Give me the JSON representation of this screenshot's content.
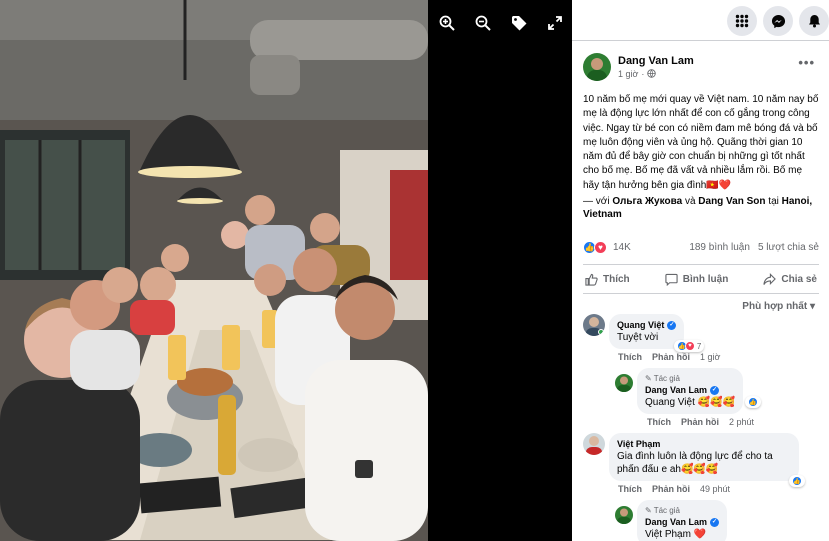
{
  "viewer": {
    "tools": [
      "zoom-in-icon",
      "zoom-out-icon",
      "tag-icon",
      "fullscreen-icon"
    ]
  },
  "topbar": {
    "icons": [
      "menu-grid-icon",
      "messenger-icon",
      "notifications-icon"
    ]
  },
  "post": {
    "author": "Dang Van Lam",
    "time": "1 giờ",
    "text": "10 năm bố mẹ mới quay về Việt nam. 10 năm nay bố mẹ là động lực lớn nhất để con cố gắng trong công việc. Ngay từ bé con có niềm đam mê bóng đá và bố mẹ luôn động viên và ủng hộ. Quãng thời gian 10 năm đủ để bây giờ con chuẩn bị những gì tốt nhất cho bố mẹ. Bố mẹ đã vất vả nhiều lắm rồi. Bố mẹ hãy tận hưởng bên gia đình🇻🇳❤️",
    "with_prefix": "— với",
    "with_person1": "Ольга Жукова",
    "with_and": "và",
    "with_person2": "Dang Van Son",
    "with_at": "tại",
    "location": "Hanoi, Vietnam",
    "reactions_count": "14K",
    "comments_count": "189 bình luận",
    "shares_count": "5 lượt chia sẻ"
  },
  "actions": {
    "like": "Thích",
    "comment": "Bình luận",
    "share": "Chia sẻ"
  },
  "sort_label": "Phù hợp nhất",
  "comments": [
    {
      "name": "Quang Việt",
      "text": "Tuyệt vời",
      "reaction_count": "7",
      "like": "Thích",
      "reply": "Phản hồi",
      "time": "1 giờ"
    },
    {
      "tag": "Tác giả",
      "name": "Dang Van Lam",
      "text": "Quang Việt 🥰🥰🥰",
      "like": "Thích",
      "reply": "Phản hồi",
      "time": "2 phút"
    },
    {
      "name": "Việt Phạm",
      "text": "Gia đình luôn là động lực để cho ta phấn đấu e ah🥰🥰🥰",
      "like": "Thích",
      "reply": "Phản hồi",
      "time": "49 phút"
    },
    {
      "tag": "Tác giả",
      "name": "Dang Van Lam",
      "text": "Việt Phạm ❤️"
    }
  ],
  "colors": {
    "accent": "#1877f2",
    "love": "#f33e58"
  }
}
